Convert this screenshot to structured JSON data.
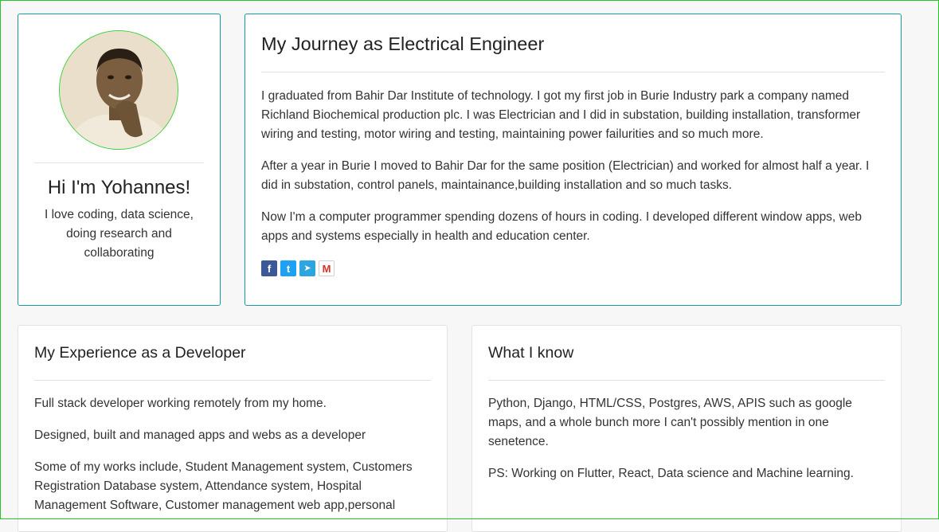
{
  "profile": {
    "name": "Hi I'm Yohannes!",
    "bio": "I love coding, data science, doing research and collaborating"
  },
  "journey": {
    "title": "My Journey as Electrical Engineer",
    "paragraphs": [
      "I graduated from Bahir Dar Institute of technology. I got my first job in Burie Industry park a company named Richland Biochemical production plc. I was Electrician and I did in substation, building installation, transformer wiring and testing, motor wiring and testing, maintaining power failurities and so much more.",
      "After a year in Burie I moved to Bahir Dar for the same position (Electrician) and worked for almost half a year. I did in substation, control panels, maintainance,building installation and so much tasks.",
      "Now I'm a computer programmer spending dozens of hours in coding. I developed different window apps, web apps and systems especially in health and education center."
    ],
    "social": [
      {
        "icon": "facebook-icon",
        "glyph": "f",
        "color": "#3b5998"
      },
      {
        "icon": "twitter-icon",
        "glyph": "t",
        "color": "#1da1f2"
      },
      {
        "icon": "telegram-icon",
        "glyph": "➤",
        "color": "#2ca5e0"
      },
      {
        "icon": "gmail-icon",
        "glyph": "M",
        "color": "#ffffff"
      }
    ]
  },
  "experience": {
    "title": "My Experience as a Developer",
    "paragraphs": [
      "Full stack developer working remotely from my home.",
      "Designed, built and managed apps and webs as a developer",
      "Some of my works include, Student Management system, Customers Registration Database system, Attendance system, Hospital Management Software, Customer management web app,personal"
    ]
  },
  "know": {
    "title": "What I know",
    "paragraphs": [
      "Python, Django, HTML/CSS, Postgres, AWS, APIS such as google maps, and a whole bunch more I can't possibly mention in one senetence.",
      "PS: Working on Flutter, React, Data science and Machine learning."
    ]
  }
}
